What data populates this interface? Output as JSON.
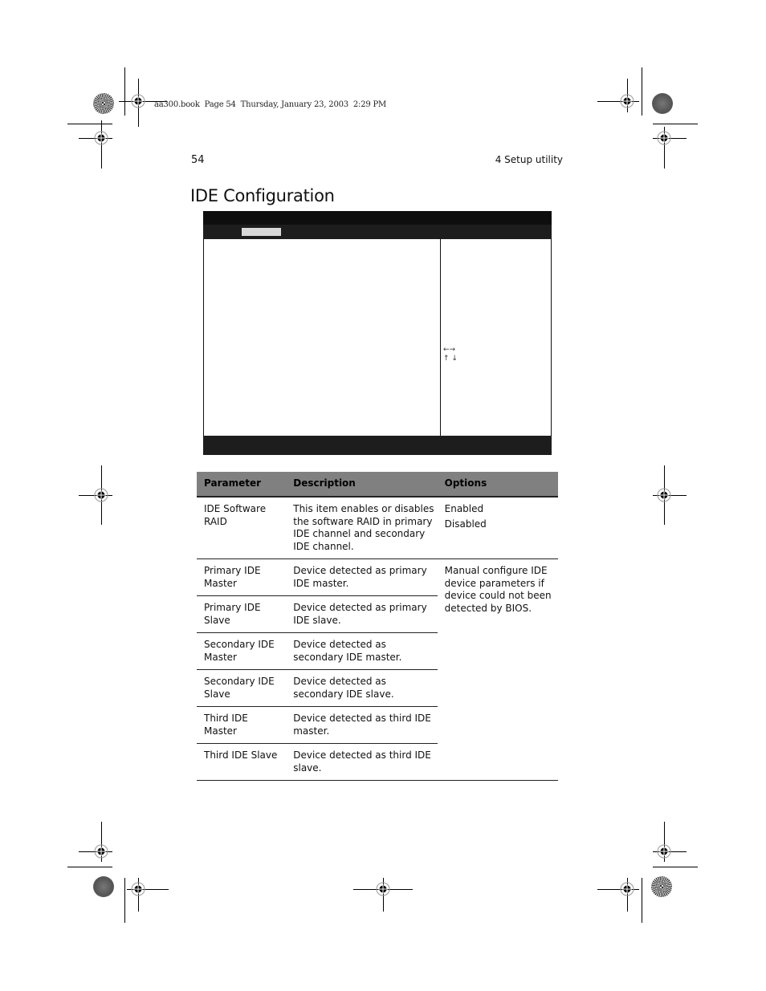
{
  "print_header": "aa300.book  Page 54  Thursday, January 23, 2003  2:29 PM",
  "page_number": "54",
  "chapter": "4 Setup utility",
  "title": "IDE Configuration",
  "bios_screen": {
    "nav_arrows": {
      "left_right": "←→",
      "up_down": "↑ ↓"
    }
  },
  "table": {
    "headers": [
      "Parameter",
      "Description",
      "Options"
    ],
    "rows": [
      {
        "parameter": "IDE Software RAID",
        "description": "This item enables or disables the software RAID in primary IDE channel and secondary IDE channel.",
        "options": [
          "Enabled",
          "Disabled"
        ]
      },
      {
        "parameter": "Primary IDE Master",
        "description": "Device detected as primary IDE master."
      },
      {
        "parameter": "Primary IDE Slave",
        "description": "Device detected as primary IDE slave."
      },
      {
        "parameter": "Secondary IDE Master",
        "description": "Device detected as secondary IDE master."
      },
      {
        "parameter": "Secondary IDE Slave",
        "description": "Device detected as secondary IDE slave."
      },
      {
        "parameter": "Third IDE Master",
        "description": "Device detected as third IDE master."
      },
      {
        "parameter": "Third IDE Slave",
        "description": "Device detected as third IDE slave."
      }
    ],
    "shared_option": "Manual configure IDE device parameters if device could not been detected by BIOS."
  }
}
